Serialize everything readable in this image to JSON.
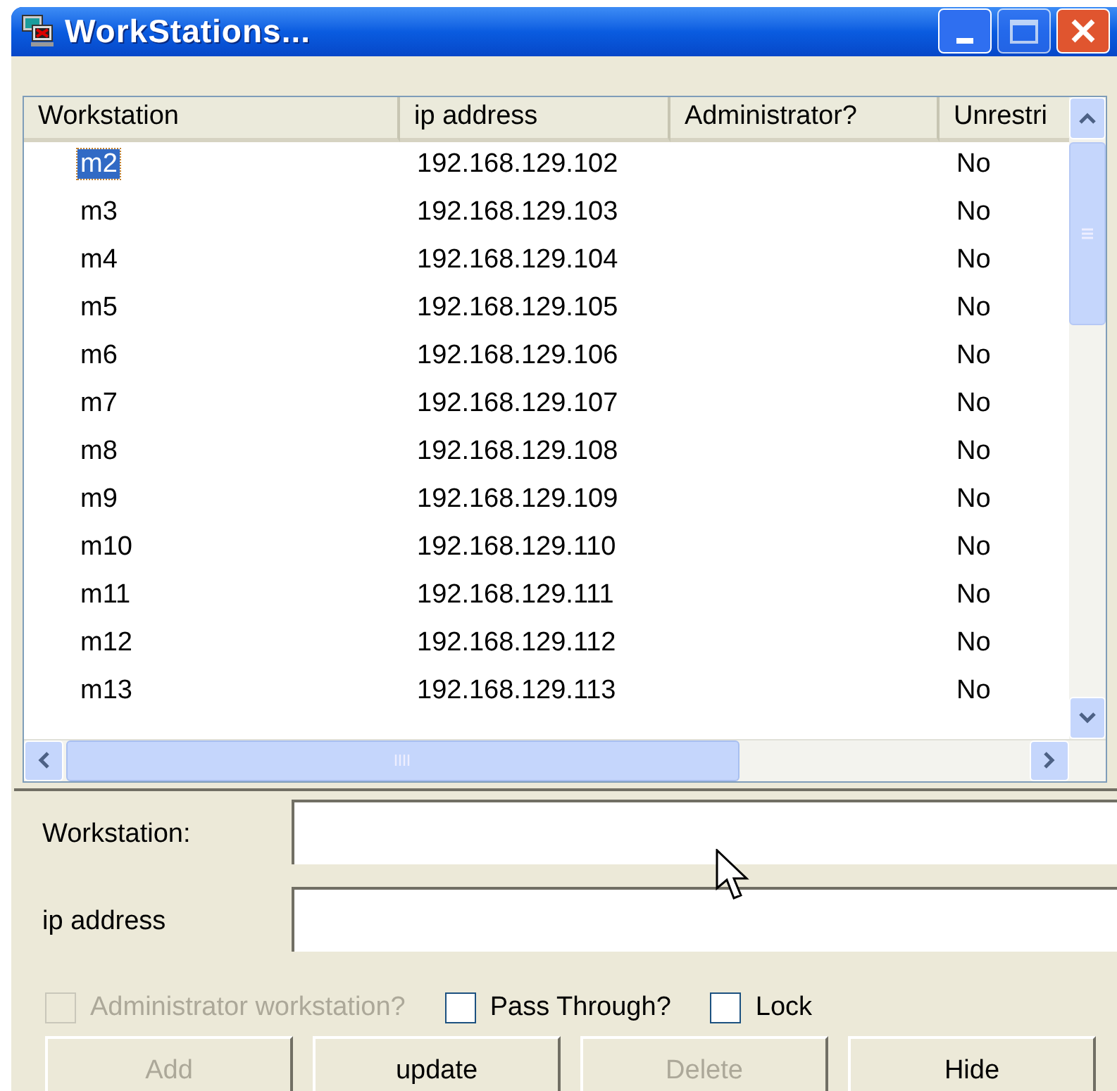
{
  "window": {
    "title": "WorkStations..."
  },
  "table": {
    "columns": [
      "Workstation",
      "ip address",
      "Administrator?",
      "Unrestri"
    ],
    "rows": [
      {
        "cells": [
          "m2",
          "192.168.129.102",
          "",
          "No"
        ],
        "selected": true
      },
      {
        "cells": [
          "m3",
          "192.168.129.103",
          "",
          "No"
        ],
        "selected": false
      },
      {
        "cells": [
          "m4",
          "192.168.129.104",
          "",
          "No"
        ],
        "selected": false
      },
      {
        "cells": [
          "m5",
          "192.168.129.105",
          "",
          "No"
        ],
        "selected": false
      },
      {
        "cells": [
          "m6",
          "192.168.129.106",
          "",
          "No"
        ],
        "selected": false
      },
      {
        "cells": [
          "m7",
          "192.168.129.107",
          "",
          "No"
        ],
        "selected": false
      },
      {
        "cells": [
          "m8",
          "192.168.129.108",
          "",
          "No"
        ],
        "selected": false
      },
      {
        "cells": [
          "m9",
          "192.168.129.109",
          "",
          "No"
        ],
        "selected": false
      },
      {
        "cells": [
          "m10",
          "192.168.129.110",
          "",
          "No"
        ],
        "selected": false
      },
      {
        "cells": [
          "m11",
          "192.168.129.111",
          "",
          "No"
        ],
        "selected": false
      },
      {
        "cells": [
          "m12",
          "192.168.129.112",
          "",
          "No"
        ],
        "selected": false
      },
      {
        "cells": [
          "m13",
          "192.168.129.113",
          "",
          "No"
        ],
        "selected": false
      }
    ]
  },
  "fields": [
    {
      "label": "Workstation:"
    },
    {
      "label": "ip address"
    }
  ],
  "checkboxes": [
    {
      "label": "Administrator workstation?",
      "checked": false,
      "disabled": true
    },
    {
      "label": "Pass Through?",
      "checked": false,
      "disabled": false
    },
    {
      "label": "Lock",
      "checked": false,
      "disabled": false
    }
  ],
  "buttons": [
    {
      "label": "Add",
      "disabled": true
    },
    {
      "label": "update",
      "disabled": false
    },
    {
      "label": "Delete",
      "disabled": true
    },
    {
      "label": "Hide",
      "disabled": false
    }
  ]
}
